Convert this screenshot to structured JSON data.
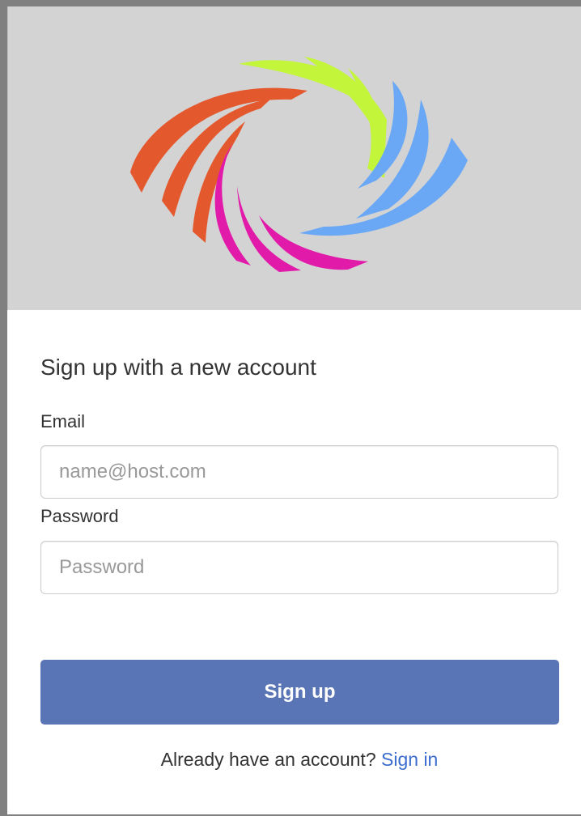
{
  "logo": {
    "icon": "swirl-logo-icon",
    "colors": {
      "orange": "#e4582e",
      "lime": "#c3f53a",
      "blue": "#6aa8f5",
      "magenta": "#e21aa9"
    }
  },
  "form": {
    "heading": "Sign up with a new account",
    "email_label": "Email",
    "email_placeholder": "name@host.com",
    "email_value": "",
    "password_label": "Password",
    "password_placeholder": "Password",
    "password_value": "",
    "submit_label": "Sign up"
  },
  "footer": {
    "prompt": "Already have an account?",
    "link_label": "Sign in"
  },
  "theme": {
    "button_color": "#5a75b6",
    "link_color": "#3c6ccf",
    "banner_color": "#d3d3d3"
  }
}
